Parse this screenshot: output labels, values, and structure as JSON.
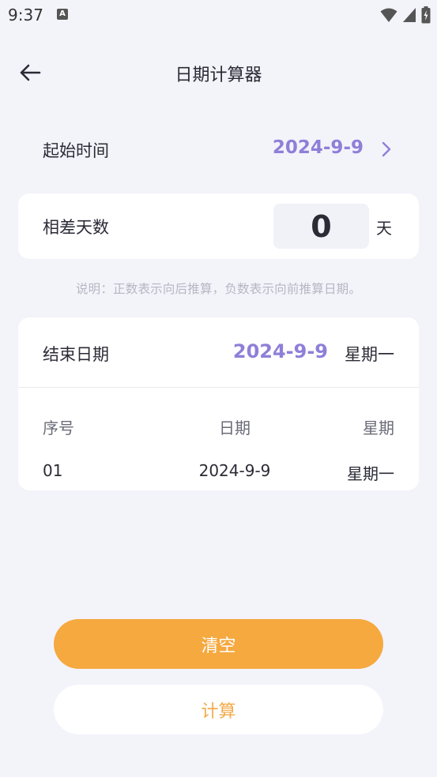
{
  "status_bar": {
    "time": "9:37",
    "notification_letter": "A"
  },
  "header": {
    "title": "日期计算器"
  },
  "start": {
    "label": "起始时间",
    "value": "2024-9-9"
  },
  "diff": {
    "label": "相差天数",
    "value": "0",
    "unit": "天"
  },
  "note": "说明：正数表示向后推算，负数表示向前推算日期。",
  "result": {
    "end_label": "结束日期",
    "end_value": "2024-9-9",
    "end_weekday": "星期一",
    "headers": [
      "序号",
      "日期",
      "星期"
    ],
    "rows": [
      [
        "01",
        "2024-9-9",
        "星期一"
      ]
    ]
  },
  "buttons": {
    "clear": "清空",
    "calculate": "计算"
  },
  "colors": {
    "accent_purple": "#8f7fd8",
    "button_orange": "#f5a93f",
    "background": "#f3f3fa"
  }
}
